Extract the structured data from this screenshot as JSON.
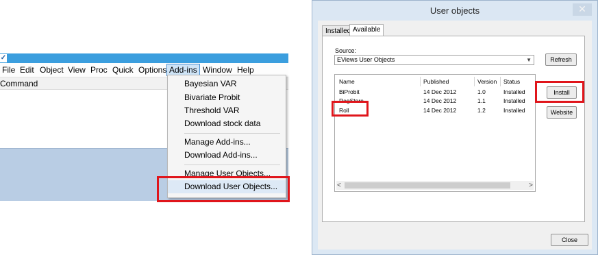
{
  "left_window": {
    "app_icon": "eviews-logo-icon",
    "menu": [
      "File",
      "Edit",
      "Object",
      "View",
      "Proc",
      "Quick",
      "Options",
      "Add-ins",
      "Window",
      "Help"
    ],
    "active_menu": "Add-ins",
    "command_label": "Command",
    "dropdown": {
      "group1": [
        "Bayesian VAR",
        "Bivariate Probit",
        "Threshold VAR",
        "Download stock data"
      ],
      "group2": [
        "Manage Add-ins...",
        "Download Add-ins..."
      ],
      "group3": [
        "Manage User Objects...",
        "Download User Objects..."
      ]
    },
    "highlight_color": "#e0151b"
  },
  "dialog": {
    "title": "User objects",
    "close_glyph": "✕",
    "tabs": [
      "Installed",
      "Available"
    ],
    "selected_tab": "Available",
    "source_label": "Source:",
    "source_value": "EViews User Objects",
    "buttons": {
      "refresh": "Refresh",
      "install": "Install",
      "website": "Website",
      "close": "Close"
    },
    "table": {
      "headers": [
        "Name",
        "Published",
        "Version",
        "Status"
      ],
      "rows": [
        [
          "BiProbit",
          "14 Dec 2012",
          "1.0",
          "Installed"
        ],
        [
          "RegStore",
          "14 Dec 2012",
          "1.1",
          "Installed"
        ],
        [
          "Roll",
          "14 Dec 2012",
          "1.2",
          "Installed"
        ]
      ]
    }
  }
}
